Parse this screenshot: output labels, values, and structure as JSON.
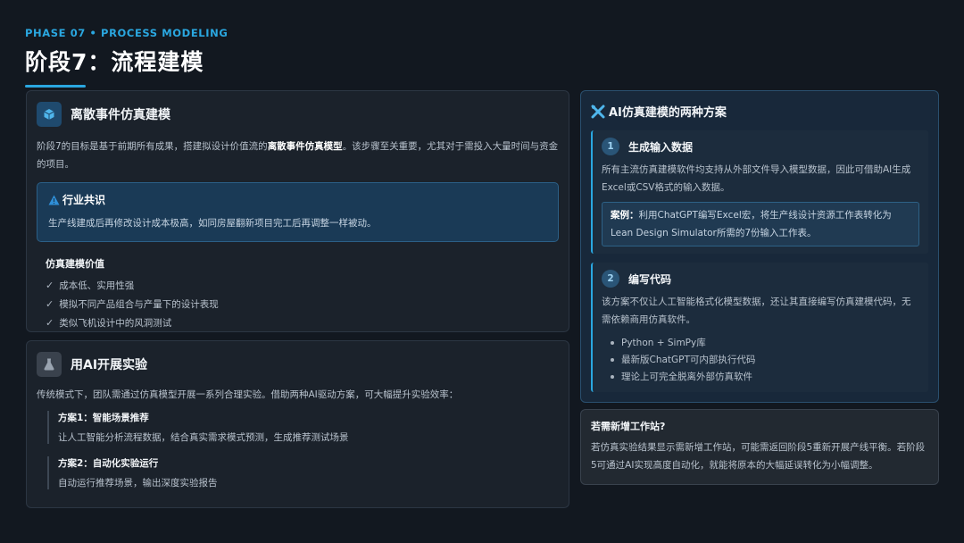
{
  "header": {
    "phase": "PHASE 07 • PROCESS MODELING",
    "title": "阶段7：流程建模"
  },
  "des_card": {
    "title": "离散事件仿真建模",
    "intro_before": "阶段7的目标是基于前期所有成果，搭建拟设计价值流的",
    "intro_bold": "离散事件仿真模型",
    "intro_after": "。该步骤至关重要，尤其对于需投入大量时间与资金的项目。",
    "consensus_title": "行业共识",
    "consensus_text": "生产线建成后再修改设计成本极高，如同房屋翻新项目完工后再调整一样被动。",
    "value_title": "仿真建模价值",
    "values": [
      "成本低、实用性强",
      "模拟不同产品组合与产量下的设计表现",
      "类似飞机设计中的风洞测试"
    ]
  },
  "exp_card": {
    "title": "用AI开展实验",
    "intro": "传统模式下，团队需通过仿真模型开展一系列合理实验。借助两种AI驱动方案，可大幅提升实验效率：",
    "plans": [
      {
        "title": "方案1：智能场景推荐",
        "text": "让人工智能分析流程数据，结合真实需求模式预测，生成推荐测试场景"
      },
      {
        "title": "方案2：自动化实验运行",
        "text": "自动运行推荐场景，输出深度实验报告"
      }
    ]
  },
  "ai_card": {
    "title": "AI仿真建模的两种方案",
    "option1": {
      "num": "1",
      "title": "生成输入数据",
      "text": "所有主流仿真建模软件均支持从外部文件导入模型数据，因此可借助AI生成Excel或CSV格式的输入数据。",
      "example_label": "案例：",
      "example_text": "利用ChatGPT编写Excel宏，将生产线设计资源工作表转化为Lean Design Simulator所需的7份输入工作表。"
    },
    "option2": {
      "num": "2",
      "title": "编写代码",
      "text": "该方案不仅让人工智能格式化模型数据，还让其直接编写仿真建模代码，无需依赖商用仿真软件。",
      "bullets": [
        "Python + SimPy库",
        "最新版ChatGPT可内部执行代码",
        "理论上可完全脱离外部仿真软件"
      ]
    }
  },
  "note_card": {
    "title": "若需新增工作站?",
    "text": "若仿真实验结果显示需新增工作站，可能需返回阶段5重新开展产线平衡。若阶段5可通过AI实现高度自动化，就能将原本的大幅延误转化为小幅调整。"
  },
  "colors": {
    "accent": "#2aa7e0",
    "background": "#121820",
    "warning": "#2f8fd8"
  }
}
